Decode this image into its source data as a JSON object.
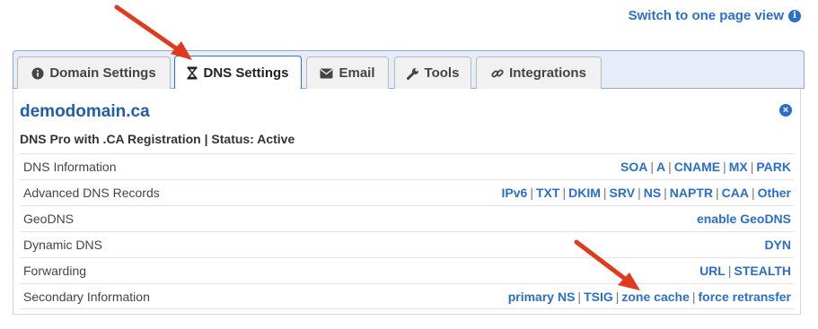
{
  "switch_view": {
    "label": "Switch to one page view",
    "icon": "info-circle-icon"
  },
  "tabs": [
    {
      "label": "Domain Settings",
      "icon": "info-circle-icon",
      "active": false
    },
    {
      "label": "DNS Settings",
      "icon": "hourglass-icon",
      "active": true
    },
    {
      "label": "Email",
      "icon": "envelope-icon",
      "active": false
    },
    {
      "label": "Tools",
      "icon": "wrench-icon",
      "active": false
    },
    {
      "label": "Integrations",
      "icon": "link-icon",
      "active": false
    }
  ],
  "domain": {
    "name": "demodomain.ca",
    "plan_status": "DNS Pro with .CA Registration | Status: Active"
  },
  "rows": [
    {
      "label": "DNS Information",
      "links": [
        "SOA",
        "A",
        "CNAME",
        "MX",
        "PARK"
      ]
    },
    {
      "label": "Advanced DNS Records",
      "links": [
        "IPv6",
        "TXT",
        "DKIM",
        "SRV",
        "NS",
        "NAPTR",
        "CAA",
        "Other"
      ]
    },
    {
      "label": "GeoDNS",
      "links": [
        "enable GeoDNS"
      ]
    },
    {
      "label": "Dynamic DNS",
      "links": [
        "DYN"
      ]
    },
    {
      "label": "Forwarding",
      "links": [
        "URL",
        "STEALTH"
      ]
    },
    {
      "label": "Secondary Information",
      "links": [
        "primary NS",
        "TSIG",
        "zone cache",
        "force retransfer"
      ]
    }
  ],
  "colors": {
    "link": "#2a6fc9",
    "title": "#1f5ea8",
    "arrow": "#e03a1e",
    "tabbar": "#e6edf8"
  }
}
